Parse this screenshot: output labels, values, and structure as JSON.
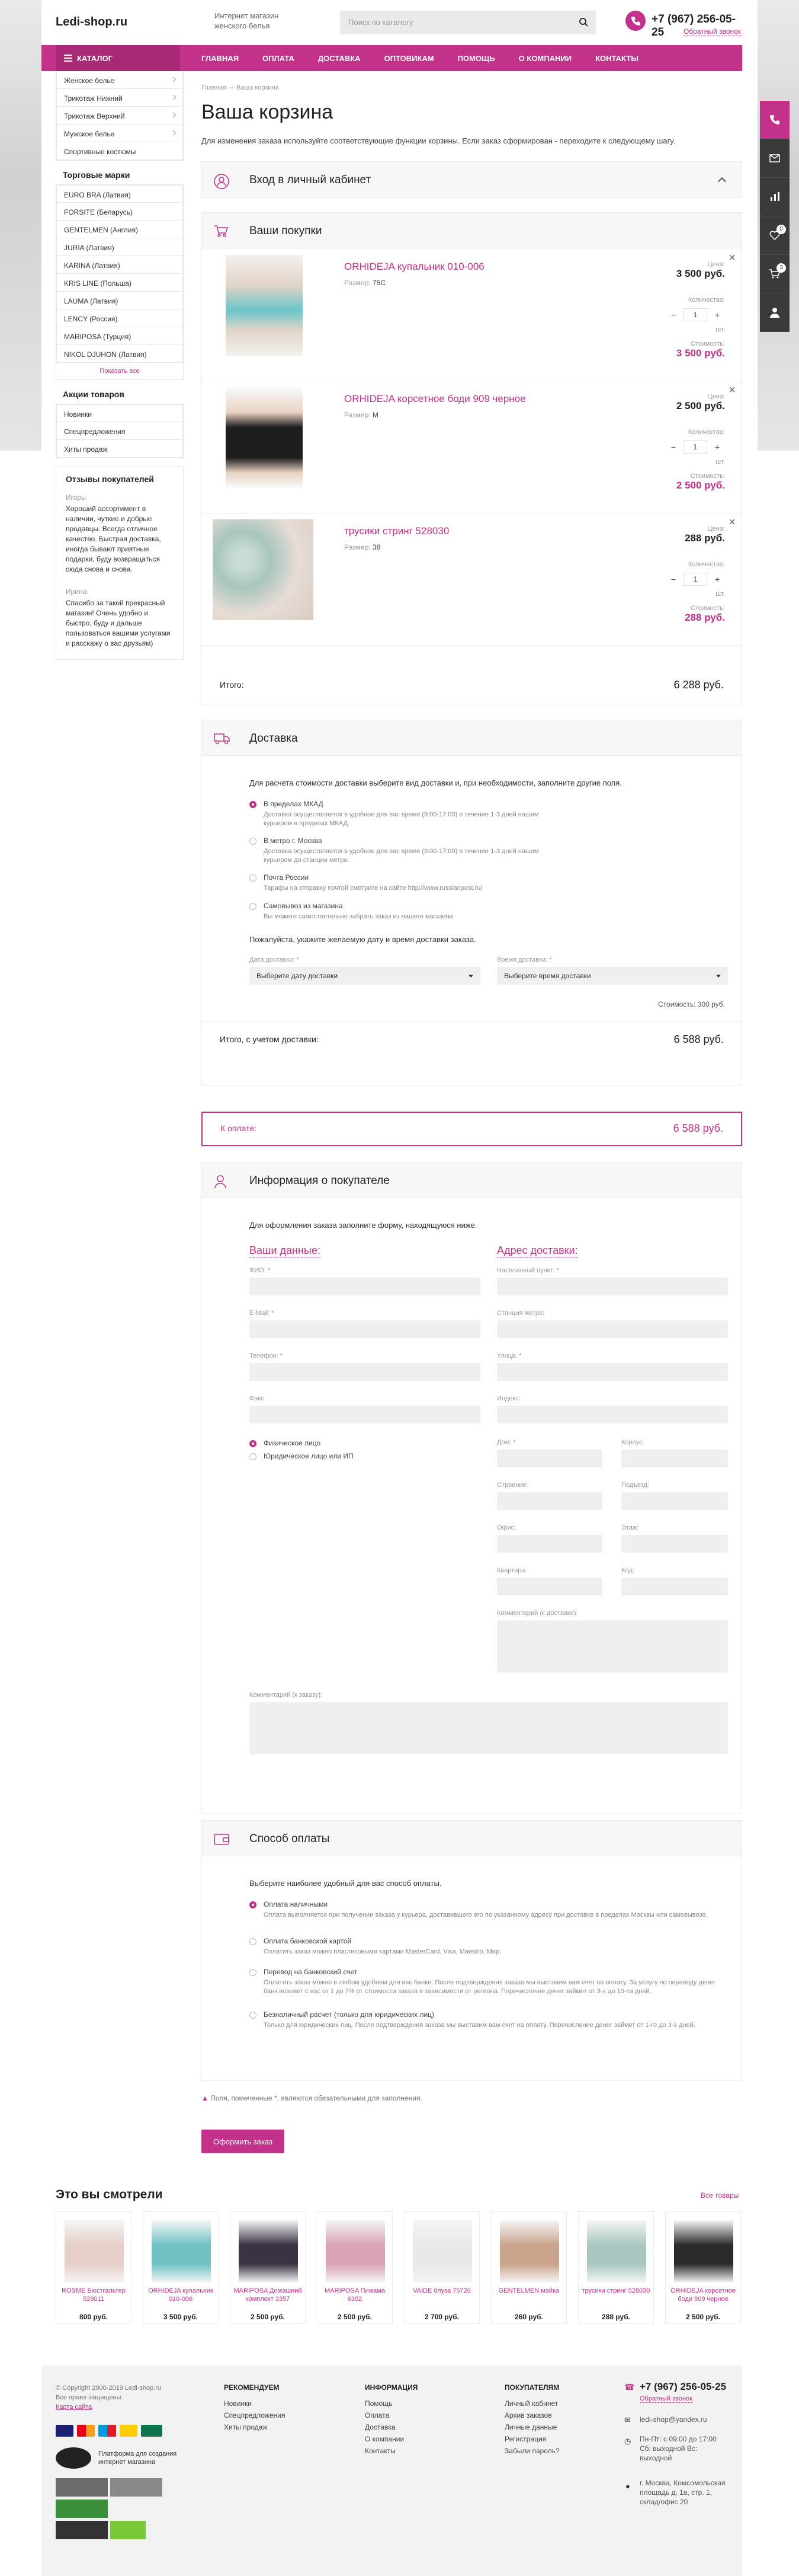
{
  "header": {
    "logo": "Ledi-shop.ru",
    "tagline": "Интернет магазин женского белья",
    "search_placeholder": "Поиск по каталогу",
    "phone": "+7 (967) 256-05-25",
    "callback": "Обратный звонок"
  },
  "nav": {
    "catalog": "КАТАЛОГ",
    "items": [
      "ГЛАВНАЯ",
      "ОПЛАТА",
      "ДОСТАВКА",
      "ОПТОВИКАМ",
      "ПОМОЩЬ",
      "О КОМПАНИИ",
      "КОНТАКТЫ"
    ]
  },
  "side": {
    "cats": [
      "Женское белье",
      "Трикотаж Нижний",
      "Трикотаж Верхний",
      "Мужское белье",
      "Спортивные костюмы"
    ],
    "brands_title": "Торговые марки",
    "brands": [
      "EURO BRA (Латвия)",
      "FORSITE (Беларусь)",
      "GENTELMEN (Англия)",
      "JURIA (Латвия)",
      "KARINA (Латвия)",
      "KRIS LINE (Польша)",
      "LAUMA (Латвия)",
      "LENCY (Россия)",
      "MARIPOSA (Турция)",
      "NIKOL DJUHON (Латвия)"
    ],
    "show_all": "Показать все",
    "promo_title": "Акции товаров",
    "promo": [
      "Новинки",
      "Спецпредложения",
      "Хиты продаж"
    ],
    "reviews_title": "Отзывы покупателей",
    "reviews": [
      {
        "name": "Игорь:",
        "text": "Хороший ассортимент в наличии, чуткие и добрые продавцы. Всегда отличное качество. Быстрая доставка, иногда бывают приятные подарки, буду возвращаться сюда снова и снова."
      },
      {
        "name": "Ирина:",
        "text": "Спасибо за такой прекрасный магазин! Очень удобно и быстро, буду и дальше пользоваться вашими услугами и расскажу о вас друзьям)"
      }
    ]
  },
  "main": {
    "crumbs": "Главная  —  Ваша корзина",
    "title": "Ваша корзина",
    "lead": "Для изменения заказа используйте соответствующие функции корзины. Если заказ сформирован - переходите к следующему шагу.",
    "login_block": "Вход в личный кабинет",
    "purchases_block": "Ваши покупки",
    "labels": {
      "price": "Цена:",
      "qty": "Количество:",
      "unit": "шт.",
      "cost": "Стоимость:",
      "size": "Размер:"
    },
    "products": [
      {
        "title": "ORHIDEJA купальник 010-006",
        "size": "75С",
        "price": "3 500 руб.",
        "qty": "1",
        "cost": "3 500 руб."
      },
      {
        "title": "ORHIDEJA корсетное боди 909 черное",
        "size": "M",
        "price": "2 500 руб.",
        "qty": "1",
        "cost": "2 500 руб."
      },
      {
        "title": "трусики стринг 528030",
        "size": "38",
        "price": "288 руб.",
        "qty": "1",
        "cost": "288 руб."
      }
    ],
    "total_label": "Итого:",
    "total": "6 288 руб.",
    "delivery_block": "Доставка",
    "delivery_intro": "Для расчета стоимости доставки выберите вид доставки и, при необходимости, заполните другие поля.",
    "delivery": [
      {
        "t": "В пределах МКАД",
        "d": "Доставка осуществляется в удобное для вас время (9:00-17:00) в течение 1-3 дней нашим курьером в пределах МКАД."
      },
      {
        "t": "В метро г. Москва",
        "d": "Доставка осуществляется в удобное для вас время (9:00-17:00) в течение 1-3 дней нашим курьером до станции метро."
      },
      {
        "t": "Почта России",
        "d": "Тарифы на отправку почтой смотрите на сайте http://www.russianpost.ru/"
      },
      {
        "t": "Самовывоз из магазина",
        "d": "Вы можете самостоятельно забрать заказ из нашего магазина."
      }
    ],
    "delivery_date_intro": "Пожалуйста, укажите желаемую дату и время доставки заказа.",
    "date_label": "Дата доставки: *",
    "date_value": "Выберите дату доставки",
    "time_label": "Время доставки: *",
    "time_value": "Выберите время доставки",
    "delivery_cost": "Стоимость: 300 руб.",
    "total2_label": "Итого, с учетом доставки:",
    "total2": "6 588 руб.",
    "pay_label": "К оплате:",
    "pay_total": "6 588 руб.",
    "buyer_block": "Информация о покупателе",
    "buyer_intro": "Для оформления заказа заполните форму, находящуюся ниже.",
    "your_data": "Ваши данные:",
    "address": "Адрес доставки:",
    "left_fields": [
      "ФИО: *",
      "E-Mail: *",
      "Телефон: *",
      "Факс:"
    ],
    "right_fields": [
      "Населенный пункт: *",
      "Станция метро:",
      "Улица: *",
      "Индекс:"
    ],
    "person": [
      "Физическое лицо",
      "Юридическое лицо или ИП"
    ],
    "addr_grid": [
      [
        "Дом: *",
        "Корпус:"
      ],
      [
        "Строение:",
        "Подъезд:"
      ],
      [
        "Офис:",
        "Этаж:"
      ],
      [
        "Квартира:",
        "Код:"
      ]
    ],
    "comment_delivery": "Комментарий (к доставке):",
    "comment_order": "Комментарий (к заказу):",
    "payment_block": "Способ оплаты",
    "payment_intro": "Выберите наиболее удобный для вас способ оплаты.",
    "payments": [
      {
        "t": "Оплата наличными",
        "d": "Оплата выполняется при получении заказа у курьера, доставившего его по указанному адресу при доставке в пределах Москвы или самовывозе."
      },
      {
        "t": "Оплата банковской картой",
        "d": "Оплатить заказ можно пластиковыми картами MasterCard, Visa, Maestro, Мир."
      },
      {
        "t": "Перевод на банковский счет",
        "d": "Оплатить заказ можно в любом удобном для вас банке. После подтверждения заказа мы выставим вам счет на оплату. За услугу по переводу денег банк возьмет с вас от 1 до 7% от стоимости заказа в зависимости от региона. Перечисление денег займет от 3-х до 10-ти дней."
      },
      {
        "t": "Безналичный расчет (только для юридических лиц)",
        "d": "Только для юридических лиц. После подтверждения заказа мы выставим вам счет на оплату. Перечисление денег займет от 1-го до 3-х дней."
      }
    ],
    "required_note": "Поля, помеченные *, являются обязательными для заполнения.",
    "submit": "Оформить заказ"
  },
  "seen": {
    "title": "Это вы смотрели",
    "all": "Все товары",
    "items": [
      {
        "name": "ROSME Бюстгальтер 528011",
        "price": "800 руб.",
        "color": "#e6cfc8"
      },
      {
        "name": "ORHIDEJA купальник 010-006",
        "price": "3 500 руб.",
        "color": "#6fc1c4"
      },
      {
        "name": "MARIPOSA Домашний комплект 3357",
        "price": "2 500 руб.",
        "color": "#3a3344"
      },
      {
        "name": "MARIPOSA Пижама 6302",
        "price": "2 500 руб.",
        "color": "#d9a2b6"
      },
      {
        "name": "VAIDE блуза 75720",
        "price": "2 700 руб.",
        "color": "#e8e8e8"
      },
      {
        "name": "GENTELMEN майка",
        "price": "260 руб.",
        "color": "#c9a38c"
      },
      {
        "name": "трусики стринг 528030",
        "price": "288 руб.",
        "color": "#a9c7c0"
      },
      {
        "name": "ORHIDEJA корсетное боди 909 черное",
        "price": "2 500 руб.",
        "color": "#2a2a2a"
      }
    ]
  },
  "footer": {
    "copyright": "© Copyright 2000-2019 Ledi-shop.ru",
    "rights": "Все права защищены.",
    "sitemap": "Карта сайта",
    "expert": "Платформа для создания интернет магазина",
    "cols": [
      {
        "title": "РЕКОМЕНДУЕМ",
        "items": [
          "Новинки",
          "Спецпредложения",
          "Хиты продаж"
        ]
      },
      {
        "title": "ИНФОРМАЦИЯ",
        "items": [
          "Помощь",
          "Оплата",
          "Доставка",
          "О компании",
          "Контакты"
        ]
      },
      {
        "title": "ПОКУПАТЕЛЯМ",
        "items": [
          "Личный кабинет",
          "Архив заказов",
          "Личные данные",
          "Регистрация",
          "Забыли пароль?"
        ]
      }
    ],
    "phone": "+7 (967) 256-05-25",
    "callback": "Обратный звонок",
    "email": "ledi-shop@yandex.ru",
    "hours": "Пн-Пт: с 09:00 до 17:00 Сб: выходной Вс: выходной",
    "address": "г. Москва, Комсомольская площадь д. 1а, стр. 1, склад/офис 20"
  },
  "colors": {
    "accent": "#c3328a",
    "dark": "#3a3a3a"
  }
}
